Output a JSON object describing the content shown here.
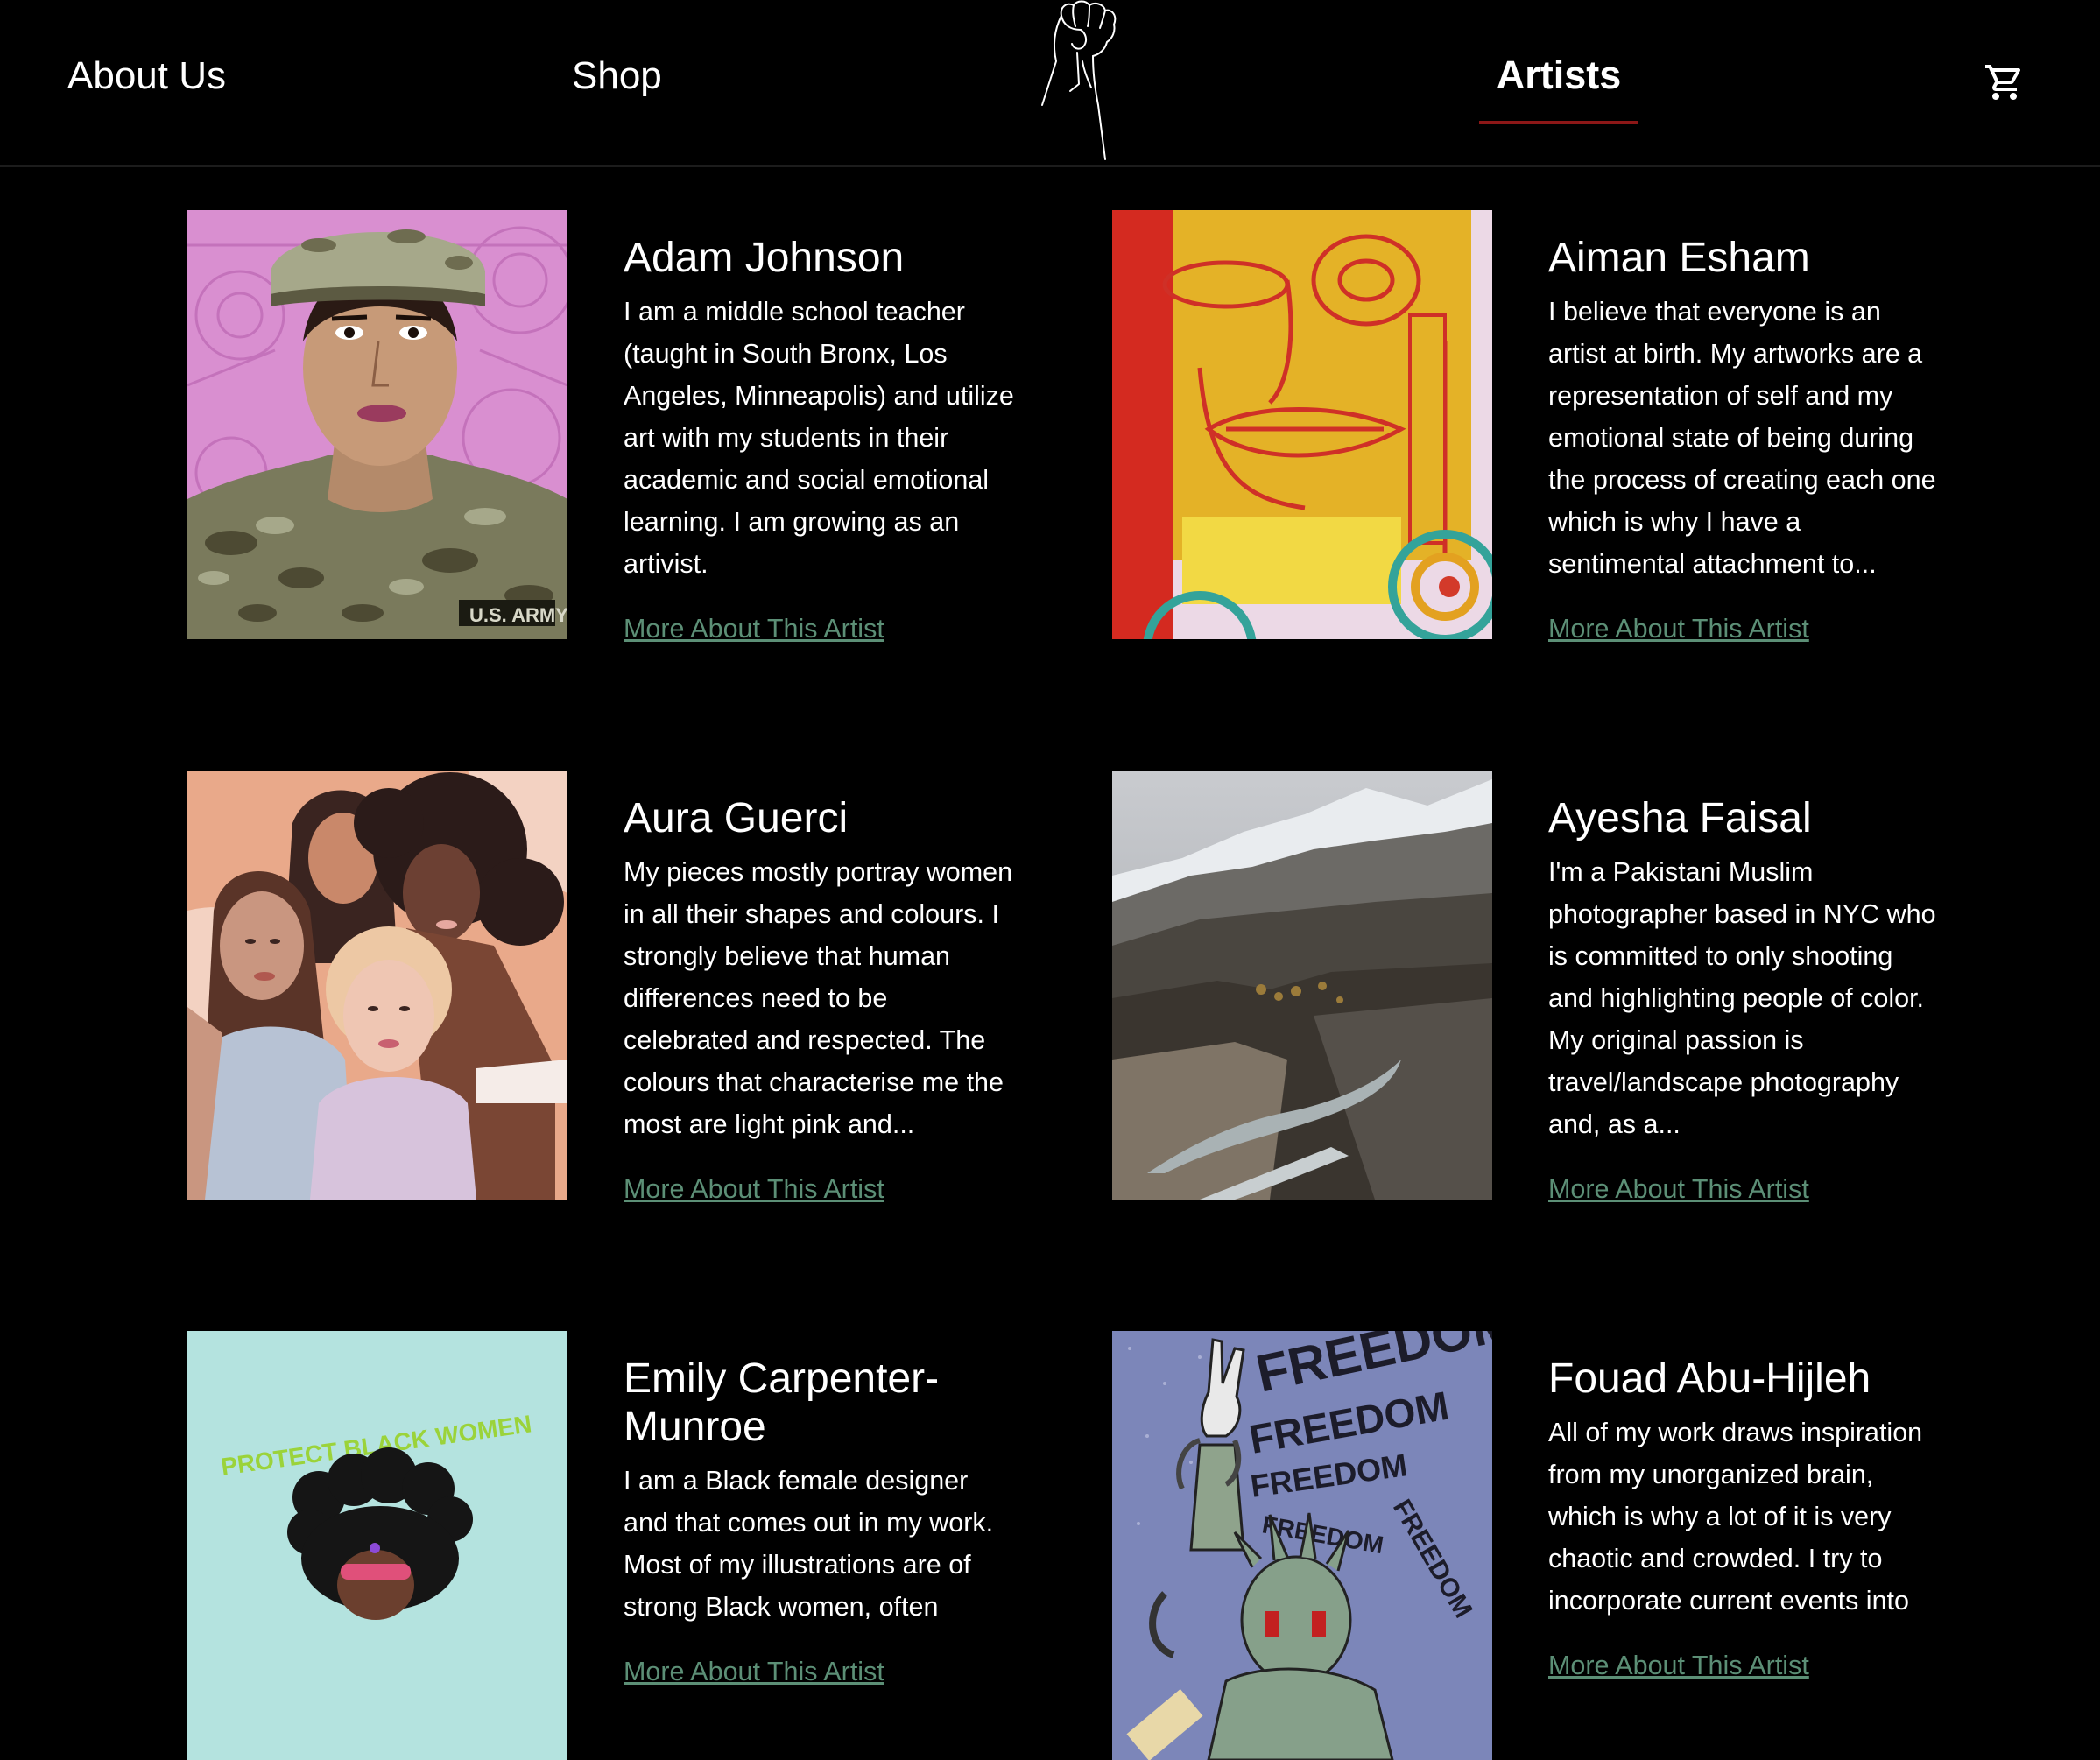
{
  "nav": {
    "about_label": "About Us",
    "shop_label": "Shop",
    "artists_label": "Artists",
    "logo_icon": "raised-fist-icon",
    "cart_icon": "shopping-cart-icon",
    "active_tab_color": "#8c1717"
  },
  "link_color": "#5c8f76",
  "artists": [
    {
      "name": "Adam Johnson",
      "bio": "I am a middle school teacher (taught in South Bronx, Los Angeles, Minneapolis) and utilize art with my students in their academic and social emotional learning. I am growing as an artivist.",
      "link": "More About This Artist",
      "image_text": "U.S. ARMY"
    },
    {
      "name": "Aiman Esham",
      "bio": "I believe that everyone is an artist at birth. My artworks are a representation of self and my emotional state of being during the process of creating each one which is why I have a sentimental attachment to...",
      "link": "More About This Artist"
    },
    {
      "name": "Aura Guerci",
      "bio": "My pieces mostly portray women in all their shapes and colours. I strongly believe that human differences need to be celebrated and respected. The colours that characterise me the most are light pink and...",
      "link": "More About This Artist"
    },
    {
      "name": "Ayesha Faisal",
      "bio": "I'm a Pakistani Muslim photographer based in NYC who is committed to only shooting and highlighting people of color. My original passion is travel/landscape photography and, as a...",
      "link": "More About This Artist"
    },
    {
      "name": "Emily Carpenter-Munroe",
      "bio": "I am a Black female designer and that comes out in my work. Most of my illustrations are of strong Black women, often",
      "link": "More About This Artist",
      "image_text": "PROTECT BLACK WOMEN"
    },
    {
      "name": "Fouad Abu-Hijleh",
      "bio": "All of my work draws inspiration from my unorganized brain, which is why a lot of it is very chaotic and crowded. I try to incorporate current events into",
      "link": "More About This Artist",
      "image_text": "FREEDOM"
    }
  ]
}
